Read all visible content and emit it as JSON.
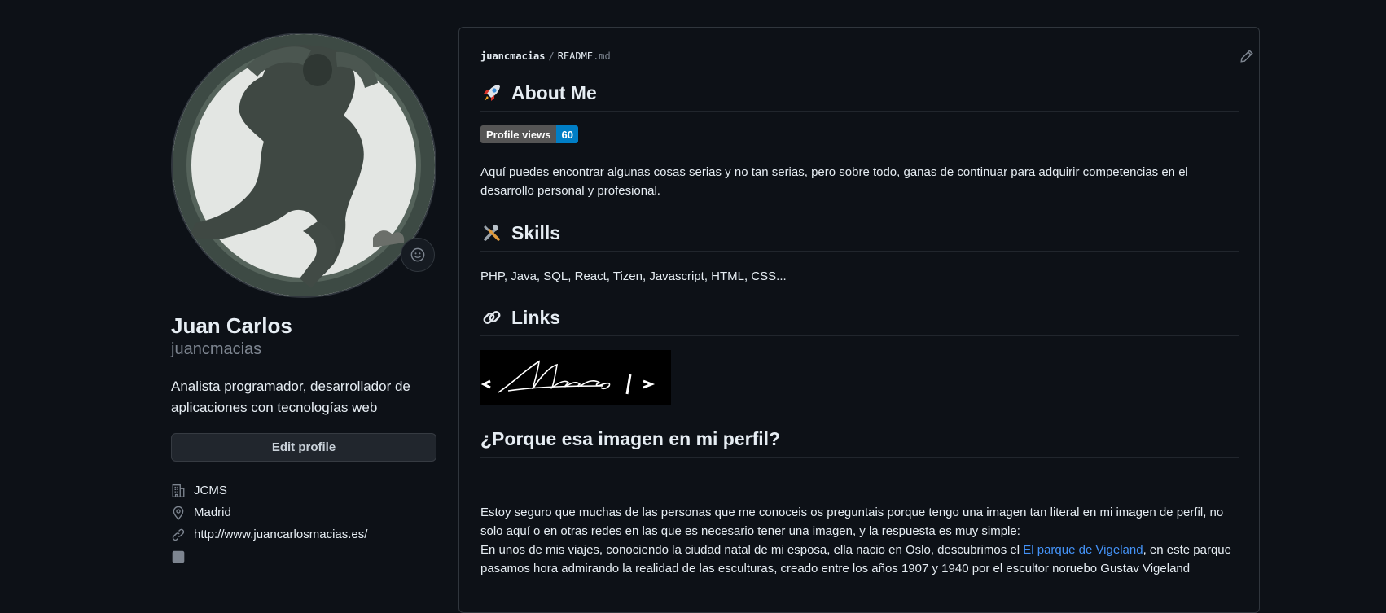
{
  "profile": {
    "name": "Juan Carlos",
    "login": "juancmacias",
    "bio": "Analista programador, desarrollador de aplicaciones con tecnologías web",
    "edit_label": "Edit profile",
    "company": "JCMS",
    "location": "Madrid",
    "website": "http://www.juancarlosmacias.es/",
    "avatar_icon": "profile-photo-statue",
    "emoji_icon": "smiley-icon"
  },
  "readme": {
    "owner": "juancmacias",
    "separator": "/",
    "file_base": "README",
    "file_ext": ".md",
    "about_title": "About Me",
    "badge_label": "Profile views",
    "badge_count": "60",
    "about_text": "Aquí puedes encontrar algunas cosas serias y no tan serias, pero sobre todo, ganas de continuar para adquirir competencias en el desarrollo personal y profesional.",
    "skills_title": "Skills",
    "skills_text": "PHP, Java, SQL, React, Tizen, Javascript, HTML, CSS...",
    "links_title": "Links",
    "logo_text": "< Macias />",
    "why_title": "¿Porque esa imagen en mi perfil?",
    "why_p1": "Estoy seguro que muchas de las personas que me conoceis os preguntais porque tengo una imagen tan literal en mi imagen de perfil, no solo aquí o en otras redes en las que es necesario tener una imagen, y la respuesta es muy simple:",
    "why_p2_before": "En unos de mis viajes, conociendo la ciudad natal de mi esposa, ella nacio en Oslo, descubrimos el ",
    "why_p2_link": "El parque de Vigeland",
    "why_p2_after": ", en este parque pasamos hora admirando la realidad de las esculturas, creado entre los años 1907 y 1940 por el escultor noruebo Gustav Vigeland"
  },
  "colors": {
    "background": "#0d1117",
    "border": "#30363d",
    "link": "#4493f8",
    "badge_left": "#555555",
    "badge_right": "#007ec6"
  }
}
